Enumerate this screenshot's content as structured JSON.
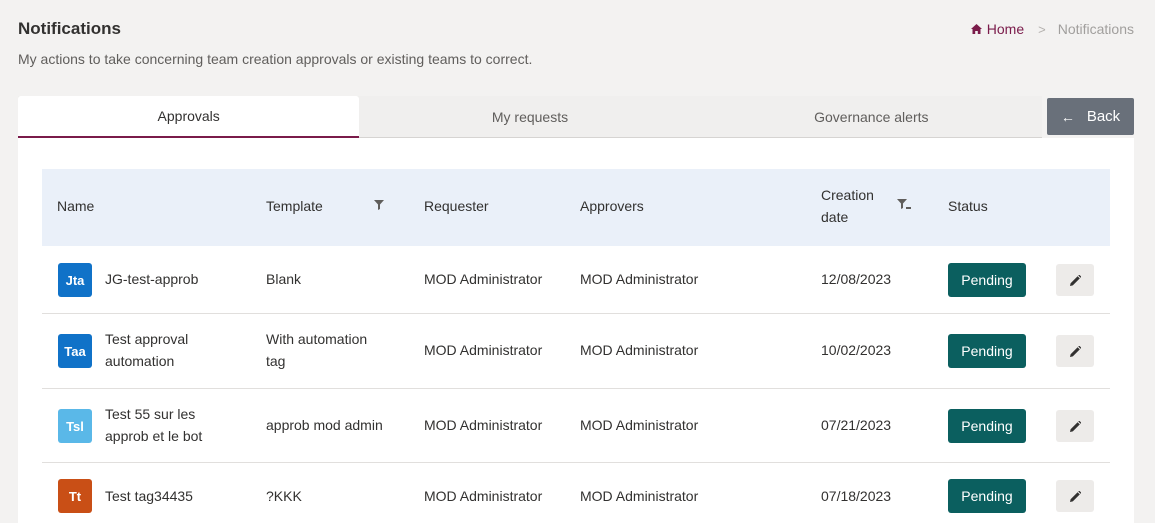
{
  "header": {
    "title": "Notifications",
    "description": "My actions to take concerning team creation approvals or existing teams to correct."
  },
  "breadcrumb": {
    "home_icon": "home-icon",
    "home": "Home",
    "separator": ">",
    "current": "Notifications"
  },
  "tabs": [
    {
      "label": "Approvals",
      "active": true
    },
    {
      "label": "My requests",
      "active": false
    },
    {
      "label": "Governance alerts",
      "active": false
    }
  ],
  "back_button": {
    "icon": "arrow-left-icon",
    "arrow": "←",
    "label": "Back"
  },
  "table": {
    "columns": {
      "name": "Name",
      "template": "Template",
      "requester": "Requester",
      "approvers": "Approvers",
      "creation_date_line1": "Creation",
      "creation_date_line2": "date",
      "status": "Status"
    },
    "rows": [
      {
        "initials": "Jta",
        "avatar_color": "#1072c8",
        "name_line1": "JG-test-approb",
        "name_line2": "",
        "template_line1": "Blank",
        "template_line2": "",
        "requester": "MOD Administrator",
        "approvers": "MOD Administrator",
        "date": "12/08/2023",
        "status": "Pending"
      },
      {
        "initials": "Taa",
        "avatar_color": "#1072c8",
        "name_line1": "Test approval",
        "name_line2": "automation",
        "template_line1": "With automation",
        "template_line2": "tag",
        "requester": "MOD Administrator",
        "approvers": "MOD Administrator",
        "date": "10/02/2023",
        "status": "Pending"
      },
      {
        "initials": "Tsl",
        "avatar_color": "#5ab8e8",
        "name_line1": "Test 55 sur les",
        "name_line2": "approb et le bot",
        "template_line1": "approb mod admin",
        "template_line2": "",
        "requester": "MOD Administrator",
        "approvers": "MOD Administrator",
        "date": "07/21/2023",
        "status": "Pending"
      },
      {
        "initials": "Tt",
        "avatar_color": "#c94f16",
        "name_line1": "Test tag34435",
        "name_line2": "",
        "template_line1": "?KKK",
        "template_line2": "",
        "requester": "MOD Administrator",
        "approvers": "MOD Administrator",
        "date": "07/18/2023",
        "status": "Pending"
      }
    ]
  },
  "colors": {
    "accent": "#7a1b4a",
    "pending": "#0b5f5f",
    "header_bg": "#eaf0f9",
    "back_button": "#69707a"
  }
}
